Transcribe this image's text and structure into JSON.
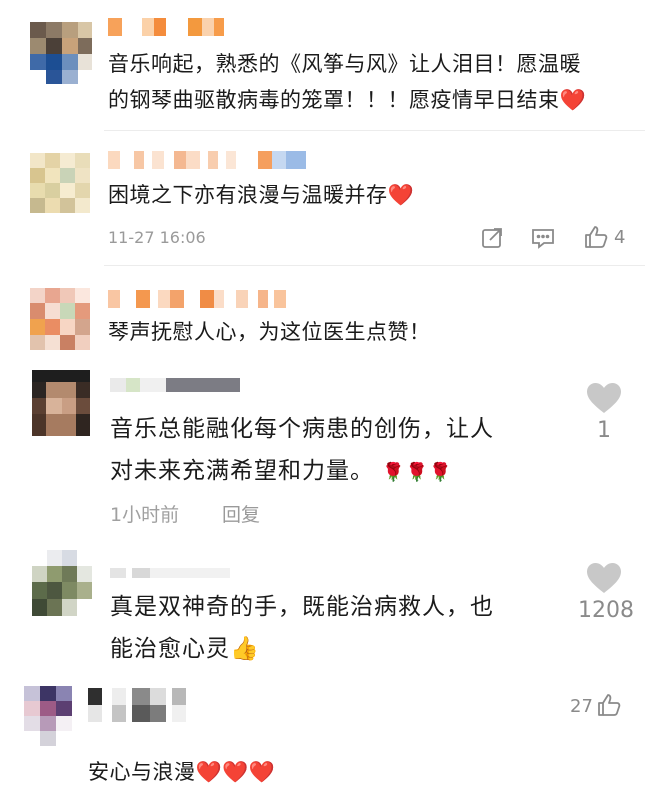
{
  "comments": [
    {
      "text_line1": "音乐响起，熟悉的《风筝与风》让人泪目！愿温暖",
      "text_line2": "的钢琴曲驱散病毒的笼罩！！！愿疫情早日结束",
      "emoji_end": "❤️"
    },
    {
      "text": "困境之下亦有浪漫与温暖并存",
      "emoji_end": "❤️",
      "time": "11-27 16:06",
      "like_count": "4",
      "share_icon": "share-icon",
      "comment_icon": "comment-icon",
      "like_icon": "thumbs-up-icon"
    },
    {
      "text": "琴声抚慰人心，为这位医生点赞！"
    },
    {
      "text_line1": "音乐总能融化每个病患的创伤，让人",
      "text_line2": "对未来充满希望和力量。",
      "emojis": "🌹🌹🌹",
      "time": "1小时前",
      "reply": "回复",
      "like_count": "1",
      "like_icon": "heart-icon"
    },
    {
      "text_line1": "真是双神奇的手，既能治病救人，也",
      "text_line2": "能治愈心灵",
      "emoji_end": "👍",
      "like_count": "1208",
      "like_icon": "heart-icon"
    },
    {
      "text": "安心与浪漫",
      "emoji_end": "❤️❤️❤️",
      "like_count": "27",
      "like_icon": "thumbs-up-icon"
    }
  ],
  "colors": {
    "heart_red": "#e0303a",
    "meta_gray": "#9a9a9a",
    "like_heart_gray": "#c8c8c8",
    "divider": "#ececec"
  }
}
